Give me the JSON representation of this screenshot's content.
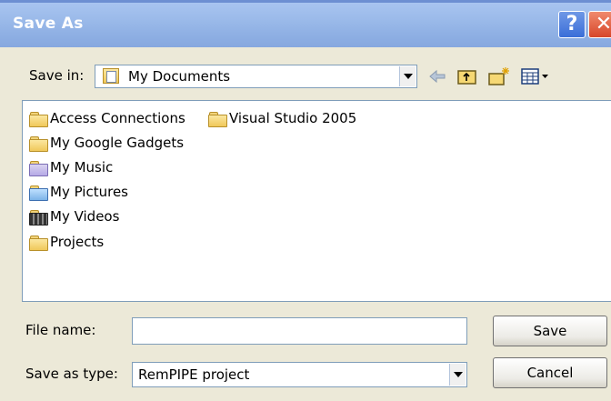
{
  "window": {
    "title": "Save As",
    "help_glyph": "?",
    "close_glyph": "✕"
  },
  "toolbar": {
    "save_in_label": "Save in:",
    "save_in_value": "My Documents",
    "icons": [
      "back-arrow-icon",
      "up-one-level-icon",
      "create-new-folder-icon",
      "view-menu-icon"
    ]
  },
  "files": [
    {
      "name": "Access Connections",
      "icon": "folder-icon"
    },
    {
      "name": "Visual Studio 2005",
      "icon": "folder-icon"
    },
    {
      "name": "My Google Gadgets",
      "icon": "folder-icon"
    },
    {
      "name": "My Music",
      "icon": "music-folder-icon"
    },
    {
      "name": "My Pictures",
      "icon": "pictures-folder-icon"
    },
    {
      "name": "My Videos",
      "icon": "videos-folder-icon"
    },
    {
      "name": "Projects",
      "icon": "folder-icon"
    }
  ],
  "form": {
    "file_name_label": "File name:",
    "file_name_value": "",
    "save_as_type_label": "Save as type:",
    "save_as_type_value": "RemPIPE project",
    "save_button": "Save",
    "cancel_button": "Cancel"
  }
}
